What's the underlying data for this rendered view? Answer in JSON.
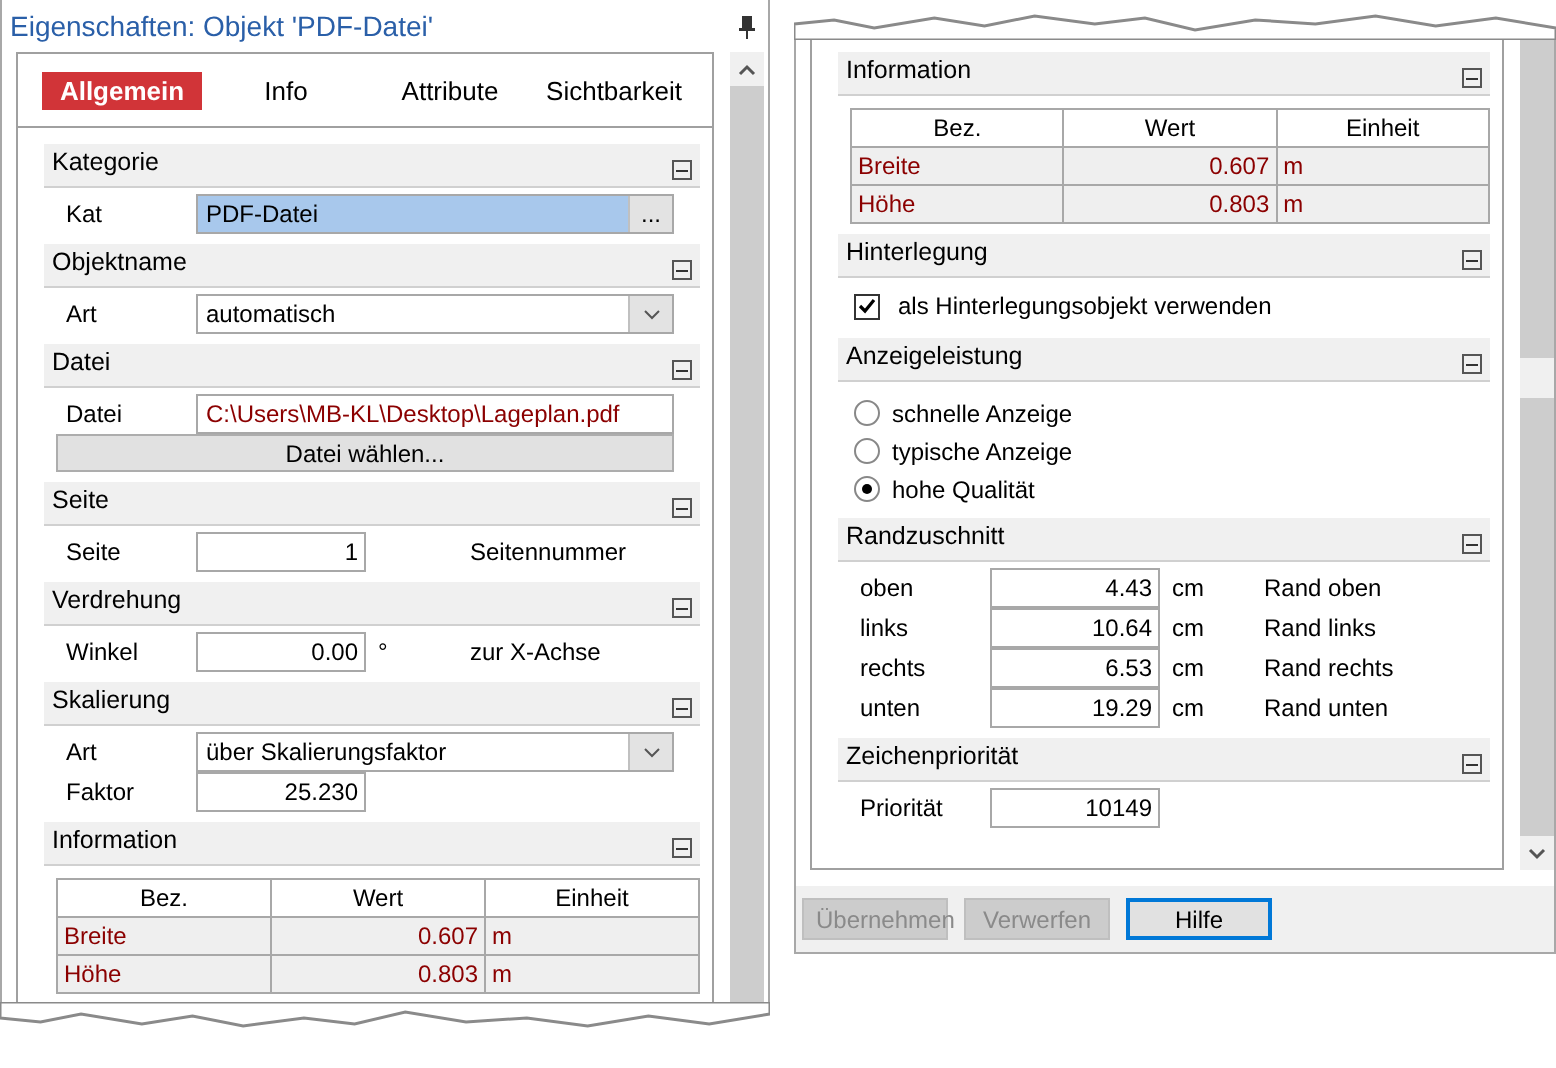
{
  "left_panel": {
    "title": "Eigenschaften: Objekt 'PDF-Datei'",
    "tabs": [
      {
        "label": "Allgemein",
        "selected": true
      },
      {
        "label": "Info",
        "selected": false
      },
      {
        "label": "Attribute",
        "selected": false
      },
      {
        "label": "Sichtbarkeit",
        "selected": false
      }
    ],
    "sections": [
      {
        "title": "Kategorie",
        "rows": [
          {
            "kind": "picker",
            "label": "Kat",
            "value": "PDF-Datei",
            "button": "..."
          }
        ]
      },
      {
        "title": "Objektname",
        "rows": [
          {
            "kind": "dropdown",
            "label": "Art",
            "value": "automatisch"
          }
        ]
      },
      {
        "title": "Datei",
        "rows": [
          {
            "kind": "file",
            "label": "Datei",
            "value": "C:\\Users\\MB-KL\\Desktop\\Lageplan.pdf",
            "button": "Datei wählen..."
          }
        ]
      },
      {
        "title": "Seite",
        "rows": [
          {
            "kind": "number",
            "label": "Seite",
            "value": "1",
            "hint": "Seitennummer"
          }
        ]
      },
      {
        "title": "Verdrehung",
        "rows": [
          {
            "kind": "number",
            "label": "Winkel",
            "value": "0.00",
            "unit": "°",
            "hint": "zur X-Achse"
          }
        ]
      },
      {
        "title": "Skalierung",
        "rows": [
          {
            "kind": "dropdown",
            "label": "Art",
            "value": "über Skalierungsfaktor"
          },
          {
            "kind": "number",
            "label": "Faktor",
            "value": "25.230"
          }
        ]
      },
      {
        "title": "Information",
        "rows": [
          {
            "kind": "table",
            "columns": [
              "Bez.",
              "Wert",
              "Einheit"
            ],
            "rows": [
              {
                "name": "Breite",
                "value": "0.607",
                "unit": "m"
              },
              {
                "name": "Höhe",
                "value": "0.803",
                "unit": "m"
              }
            ]
          }
        ]
      }
    ]
  },
  "right_panel": {
    "sections": [
      {
        "title": "Information",
        "rows": [
          {
            "kind": "table",
            "columns": [
              "Bez.",
              "Wert",
              "Einheit"
            ],
            "rows": [
              {
                "name": "Breite",
                "value": "0.607",
                "unit": "m"
              },
              {
                "name": "Höhe",
                "value": "0.803",
                "unit": "m"
              }
            ]
          }
        ]
      },
      {
        "title": "Hinterlegung",
        "rows": [
          {
            "kind": "checkbox",
            "label": "als Hinterlegungsobjekt verwenden",
            "checked": true
          }
        ]
      },
      {
        "title": "Anzeigeleistung",
        "rows": [
          {
            "kind": "radio",
            "label": "schnelle Anzeige",
            "selected": false
          },
          {
            "kind": "radio",
            "label": "typische Anzeige",
            "selected": false
          },
          {
            "kind": "radio",
            "label": "hohe Qualität",
            "selected": true
          }
        ]
      },
      {
        "title": "Randzuschnitt",
        "rows": [
          {
            "kind": "number",
            "label": "oben",
            "value": "4.43",
            "unit": "cm",
            "hint": "Rand oben"
          },
          {
            "kind": "number",
            "label": "links",
            "value": "10.64",
            "unit": "cm",
            "hint": "Rand links"
          },
          {
            "kind": "number",
            "label": "rechts",
            "value": "6.53",
            "unit": "cm",
            "hint": "Rand rechts"
          },
          {
            "kind": "number",
            "label": "unten",
            "value": "19.29",
            "unit": "cm",
            "hint": "Rand unten"
          }
        ]
      },
      {
        "title": "Zeichenpriorität",
        "rows": [
          {
            "kind": "number",
            "label": "Priorität",
            "value": "10149"
          }
        ]
      }
    ],
    "buttons": [
      {
        "label": "Übernehmen",
        "disabled": true,
        "focused": false
      },
      {
        "label": "Verwerfen",
        "disabled": true,
        "focused": false
      },
      {
        "label": "Hilfe",
        "disabled": false,
        "focused": true
      }
    ]
  }
}
